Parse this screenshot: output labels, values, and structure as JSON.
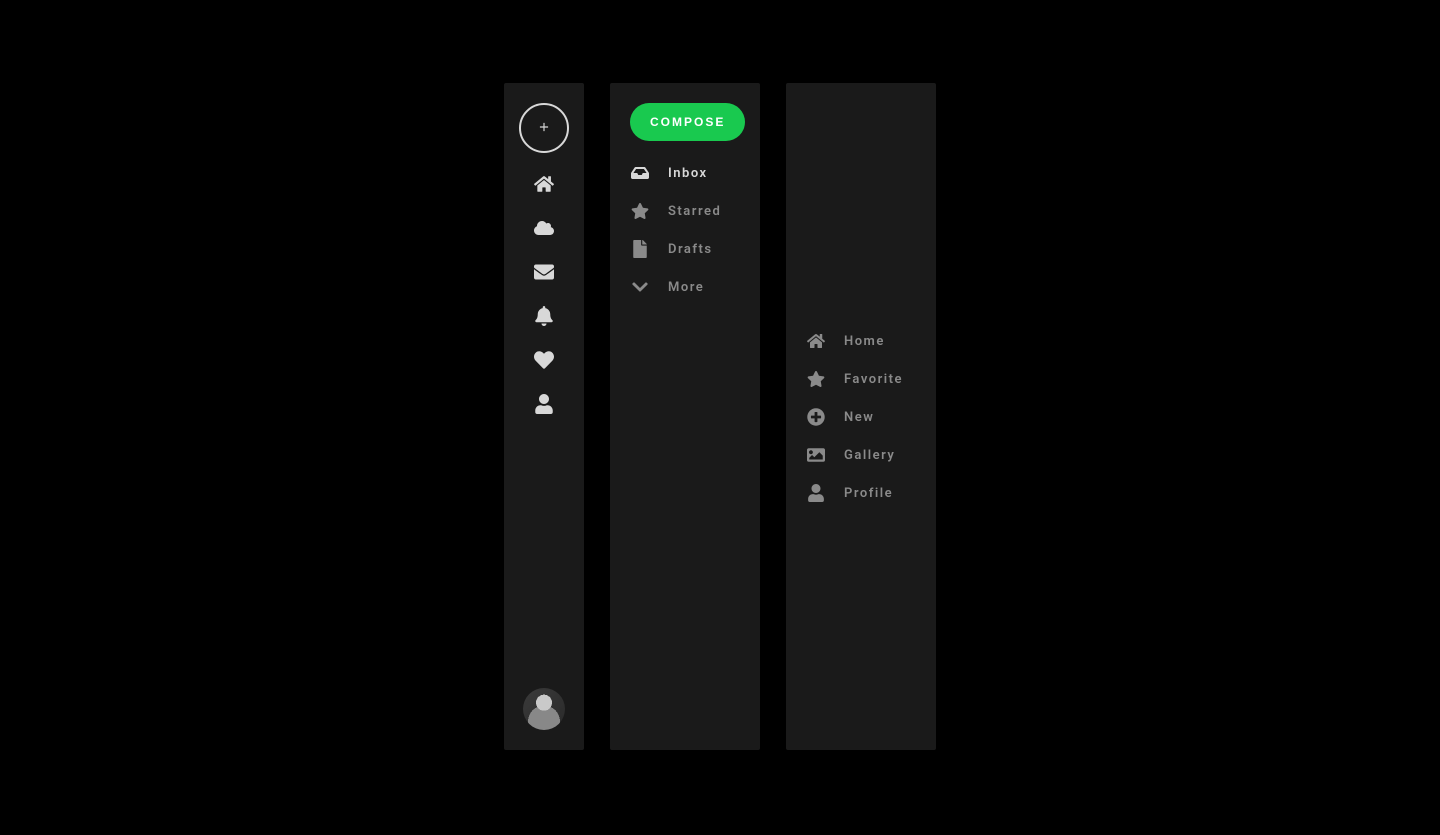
{
  "colors": {
    "bg": "#000000",
    "panel": "#1a1a1a",
    "accent": "#19c94f",
    "fg": "#d8d8d8",
    "muted": "#8a8a8a"
  },
  "panel1": {
    "addButton": {
      "icon": "plus-icon"
    },
    "icons": [
      {
        "icon": "home-icon"
      },
      {
        "icon": "cloud-icon"
      },
      {
        "icon": "mail-icon"
      },
      {
        "icon": "bell-icon"
      },
      {
        "icon": "heart-icon"
      },
      {
        "icon": "user-icon"
      }
    ],
    "avatar": {
      "name": "user-avatar"
    }
  },
  "panel2": {
    "compose_label": "COMPOSE",
    "items": [
      {
        "icon": "inbox-icon",
        "label": "Inbox",
        "active": true
      },
      {
        "icon": "star-icon",
        "label": "Starred",
        "active": false
      },
      {
        "icon": "file-icon",
        "label": "Drafts",
        "active": false
      },
      {
        "icon": "chevron-down-icon",
        "label": "More",
        "active": false
      }
    ]
  },
  "panel3": {
    "items": [
      {
        "icon": "home-icon",
        "label": "Home"
      },
      {
        "icon": "star-icon",
        "label": "Favorite"
      },
      {
        "icon": "plus-circle-icon",
        "label": "New"
      },
      {
        "icon": "image-icon",
        "label": "Gallery"
      },
      {
        "icon": "user-icon",
        "label": "Profile"
      }
    ]
  }
}
